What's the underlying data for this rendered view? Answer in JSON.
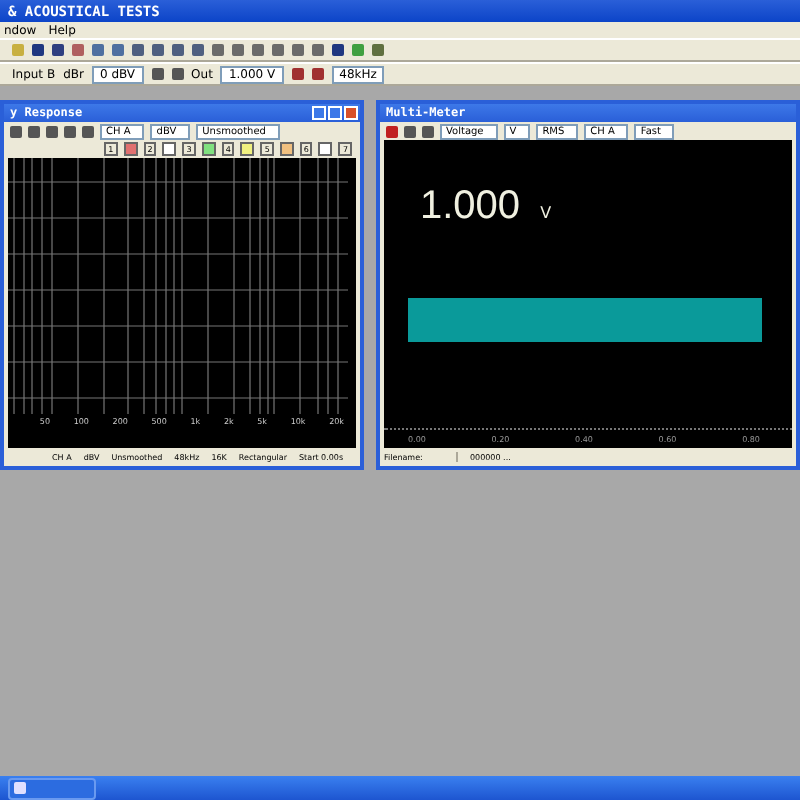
{
  "window": {
    "title": "& ACOUSTICAL TESTS"
  },
  "menu": [
    "ndow",
    "Help"
  ],
  "toolbar": {
    "input": "Input B",
    "ref": "dBr",
    "level": "0 dBV",
    "out_label": "Out",
    "out_value": "1.000 V",
    "rate": "48kHz"
  },
  "response_window": {
    "title": "y Response",
    "selects": [
      "CH A",
      "dBV",
      "Unsmoothed"
    ],
    "traces": [
      {
        "label": "1",
        "color": "#e07070"
      },
      {
        "label": "2",
        "color": "#ffffff"
      },
      {
        "label": "3",
        "color": "#80e080"
      },
      {
        "label": "4",
        "color": "#f0f080"
      },
      {
        "label": "5",
        "color": "#f0c080"
      },
      {
        "label": "6",
        "color": "#ffffff"
      },
      {
        "label": "7"
      }
    ],
    "xticks": [
      "50",
      "100",
      "200",
      "500",
      "1k",
      "2k",
      "5k",
      "10k",
      "20k"
    ],
    "status": [
      "CH A",
      "dBV",
      "Unsmoothed",
      "48kHz",
      "16K",
      "Rectangular",
      "Start 0.00s"
    ]
  },
  "meter_window": {
    "title": "Multi-Meter",
    "selects": [
      "Voltage",
      "V",
      "RMS",
      "CH A",
      "Fast"
    ],
    "reading": "1.000",
    "unit": "V",
    "level": 0.93,
    "scale": [
      "0.00",
      "0.20",
      "0.40",
      "0.60",
      "0.80"
    ],
    "status": [
      "Filename:",
      "000000 ..."
    ]
  }
}
